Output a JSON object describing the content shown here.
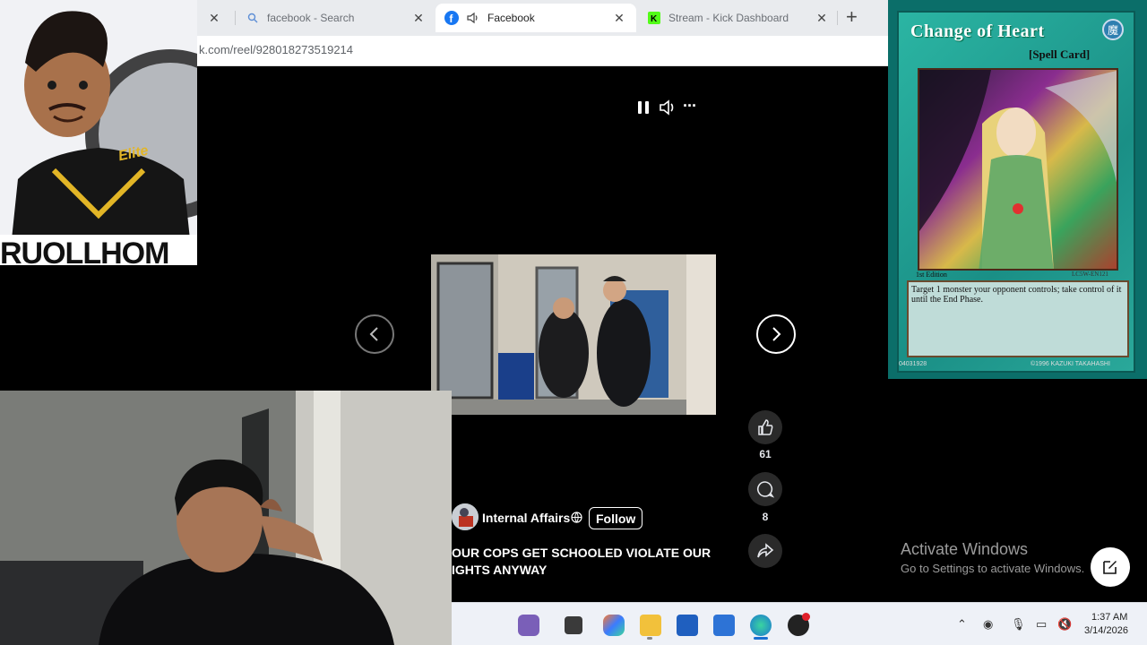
{
  "browser": {
    "tabs": [
      {
        "label": "",
        "active": false
      },
      {
        "label": "facebook - Search",
        "active": false
      },
      {
        "label": "Facebook",
        "active": true
      },
      {
        "label": "Stream - Kick Dashboard",
        "active": false
      }
    ],
    "new_tab": "+",
    "url": "k.com/reel/928018273519214"
  },
  "avatar_overlay": {
    "shirt_text": "Elite",
    "banner_text": "RUOLLHOM"
  },
  "reel": {
    "controls": {
      "pause": "pause-icon",
      "volume": "volume-icon",
      "more": "···"
    },
    "like_count": "61",
    "comment_count": "8",
    "author": "Internal Affairs",
    "follow_label": "Follow",
    "caption": "OUR COPS GET SCHOOLED VIOLATE OUR IGHTS ANYWAY"
  },
  "card": {
    "name": "Change of Heart",
    "type": "[Spell Card]",
    "edition": "1st Edition",
    "set_code": "LC5W-EN121",
    "text": "Target 1 monster your opponent controls; take control of it until the End Phase.",
    "id": "04031928",
    "copyright": "©1996 KAZUKI TAKAHASHI"
  },
  "watermark": {
    "title": "Activate Windows",
    "subtitle": "Go to Settings to activate Windows."
  },
  "taskbar": {
    "time": "1:37 AM",
    "date": "3/14/2026"
  },
  "colors": {
    "facebook_blue": "#1877f2",
    "kick_green": "#53fc18",
    "card_teal": "#1a8f86"
  }
}
